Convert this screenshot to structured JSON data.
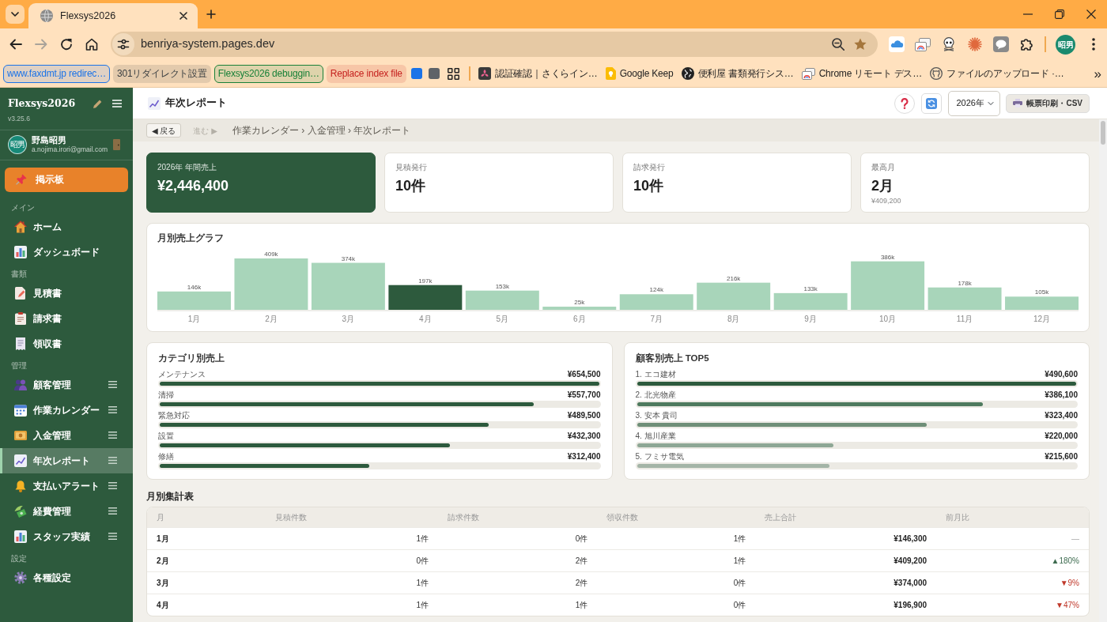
{
  "browser": {
    "tabs": [
      {
        "title": "Flexsys2026",
        "selected": true
      }
    ],
    "forward_enabled": false,
    "address": "benriya-system.pages.dev",
    "bookmarked": true,
    "profile_initials": "昭男",
    "bookmarks": [
      {
        "kind": "group",
        "label": "www.faxdmt.jp redirec…",
        "color": "#1a73e8",
        "open": true
      },
      {
        "kind": "group",
        "label": "301リダイレクト設置",
        "color": "#3c4043",
        "open": false
      },
      {
        "kind": "group",
        "label": "Flexsys2026 debuggin…",
        "color": "#188038",
        "open": true
      },
      {
        "kind": "group",
        "label": "Replace index file",
        "color": "#c5221f",
        "open": false
      },
      {
        "kind": "group",
        "color": "#1a73e8",
        "open": false
      },
      {
        "kind": "group",
        "color": "#5f6368",
        "open": false
      },
      {
        "kind": "apps"
      },
      {
        "kind": "separator"
      },
      {
        "kind": "link",
        "label": "認証確認｜さくらイン…"
      },
      {
        "kind": "link",
        "label": "Google Keep"
      },
      {
        "kind": "link",
        "label": "便利屋 書類発行シス…"
      },
      {
        "kind": "link",
        "label": "Chrome リモート デス…"
      },
      {
        "kind": "link",
        "label": "ファイルのアップロード ·…"
      }
    ],
    "bookmarks_overflow": "»"
  },
  "app": {
    "sidebar": {
      "brand": "Flexsys2026",
      "version": "v3.25.6",
      "user": {
        "initials": "昭男",
        "name": "野島昭男",
        "email": "a.nojima.irori@gmail.com"
      },
      "pinned": "掲示板",
      "sections": [
        {
          "title": "メイン",
          "items": [
            {
              "label": "ホーム",
              "selected": false,
              "handle": false
            },
            {
              "label": "ダッシュボード",
              "selected": false,
              "handle": false
            }
          ]
        },
        {
          "title": "書類",
          "items": [
            {
              "label": "見積書",
              "selected": false,
              "handle": false
            },
            {
              "label": "請求書",
              "selected": false,
              "handle": false
            },
            {
              "label": "領収書",
              "selected": false,
              "handle": false
            }
          ]
        },
        {
          "title": "管理",
          "items": [
            {
              "label": "顧客管理",
              "selected": false,
              "handle": true
            },
            {
              "label": "作業カレンダー",
              "selected": false,
              "handle": true
            },
            {
              "label": "入金管理",
              "selected": false,
              "handle": true
            },
            {
              "label": "年次レポート",
              "selected": true,
              "handle": true
            },
            {
              "label": "支払いアラート",
              "selected": false,
              "handle": true
            },
            {
              "label": "経費管理",
              "selected": false,
              "handle": true
            },
            {
              "label": "スタッフ実績",
              "selected": false,
              "handle": true
            }
          ]
        },
        {
          "title": "設定",
          "items": [
            {
              "label": "各種設定",
              "selected": false,
              "handle": false
            }
          ]
        }
      ]
    },
    "header": {
      "title": "年次レポート",
      "year": "2026年",
      "export_label": "帳票印刷・CSV"
    },
    "breadcrumb": {
      "back": "◀ 戻る",
      "forward": "進む ▶",
      "forward_disabled": true,
      "trail": "作業カレンダー › 入金管理 › 年次レポート"
    },
    "kpis": [
      {
        "label": "2026年 年間売上",
        "value": "¥2,446,400",
        "highlighted": true
      },
      {
        "label": "見積発行",
        "value": "10件",
        "highlighted": false
      },
      {
        "label": "請求発行",
        "value": "10件",
        "highlighted": false
      },
      {
        "label": "最高月",
        "value": "2月",
        "note": "¥409,200",
        "highlighted": false
      }
    ],
    "monthly_chart": {
      "chart_data": {
        "type": "bar",
        "title": "月別売上グラフ",
        "categories": [
          "1月",
          "2月",
          "3月",
          "4月",
          "5月",
          "6月",
          "7月",
          "8月",
          "9月",
          "10月",
          "11月",
          "12月"
        ],
        "values": [
          146,
          409,
          374,
          197,
          153,
          25,
          124,
          216,
          133,
          386,
          178,
          105
        ],
        "value_labels": [
          "146k",
          "409k",
          "374k",
          "197k",
          "153k",
          "25k",
          "124k",
          "216k",
          "133k",
          "386k",
          "178k",
          "105k"
        ]
      },
      "highlighted": [
        false,
        false,
        false,
        true,
        false,
        false,
        false,
        false,
        false,
        false,
        false,
        false
      ]
    },
    "category_sales": {
      "title": "カテゴリ別売上",
      "rows": [
        {
          "name": "メンテナンス",
          "amount": "¥654,500",
          "level": 1.0
        },
        {
          "name": "清掃",
          "amount": "¥557,700",
          "level": 0.852
        },
        {
          "name": "緊急対応",
          "amount": "¥489,500",
          "level": 0.748
        },
        {
          "name": "設置",
          "amount": "¥432,300",
          "level": 0.66
        },
        {
          "name": "修繕",
          "amount": "¥312,400",
          "level": 0.477
        }
      ]
    },
    "top_customers": {
      "title": "顧客別売上 TOP5",
      "rows": [
        {
          "name": "1. エコ建材",
          "amount": "¥490,600",
          "level": 1.0,
          "color": "#2d5a3d"
        },
        {
          "name": "2. 北光物産",
          "amount": "¥386,100",
          "level": 0.787,
          "color": "#4e7a5e"
        },
        {
          "name": "3. 安本 貴司",
          "amount": "¥323,400",
          "level": 0.659,
          "color": "#6f8f78"
        },
        {
          "name": "4. 旭川産業",
          "amount": "¥220,000",
          "level": 0.448,
          "color": "#8ea795"
        },
        {
          "name": "5. フミサ電気",
          "amount": "¥215,600",
          "level": 0.439,
          "color": "#a4b5a7"
        }
      ]
    },
    "monthly_table": {
      "title": "月別集計表",
      "columns": [
        "月",
        "見積件数",
        "請求件数",
        "領収件数",
        "売上合計",
        "前月比"
      ],
      "rows": [
        {
          "cells": [
            "1月",
            "1件",
            "0件",
            "1件",
            "¥146,300"
          ],
          "change": "—"
        },
        {
          "cells": [
            "2月",
            "0件",
            "2件",
            "1件",
            "¥409,200"
          ],
          "change": "▲180%",
          "color": "#3d6b4f"
        },
        {
          "cells": [
            "3月",
            "1件",
            "2件",
            "0件",
            "¥374,000"
          ],
          "change": "▼9%",
          "color": "#c0392b"
        },
        {
          "cells": [
            "4月",
            "1件",
            "1件",
            "0件",
            "¥196,900"
          ],
          "change": "▼47%",
          "color": "#c0392b"
        }
      ]
    }
  }
}
